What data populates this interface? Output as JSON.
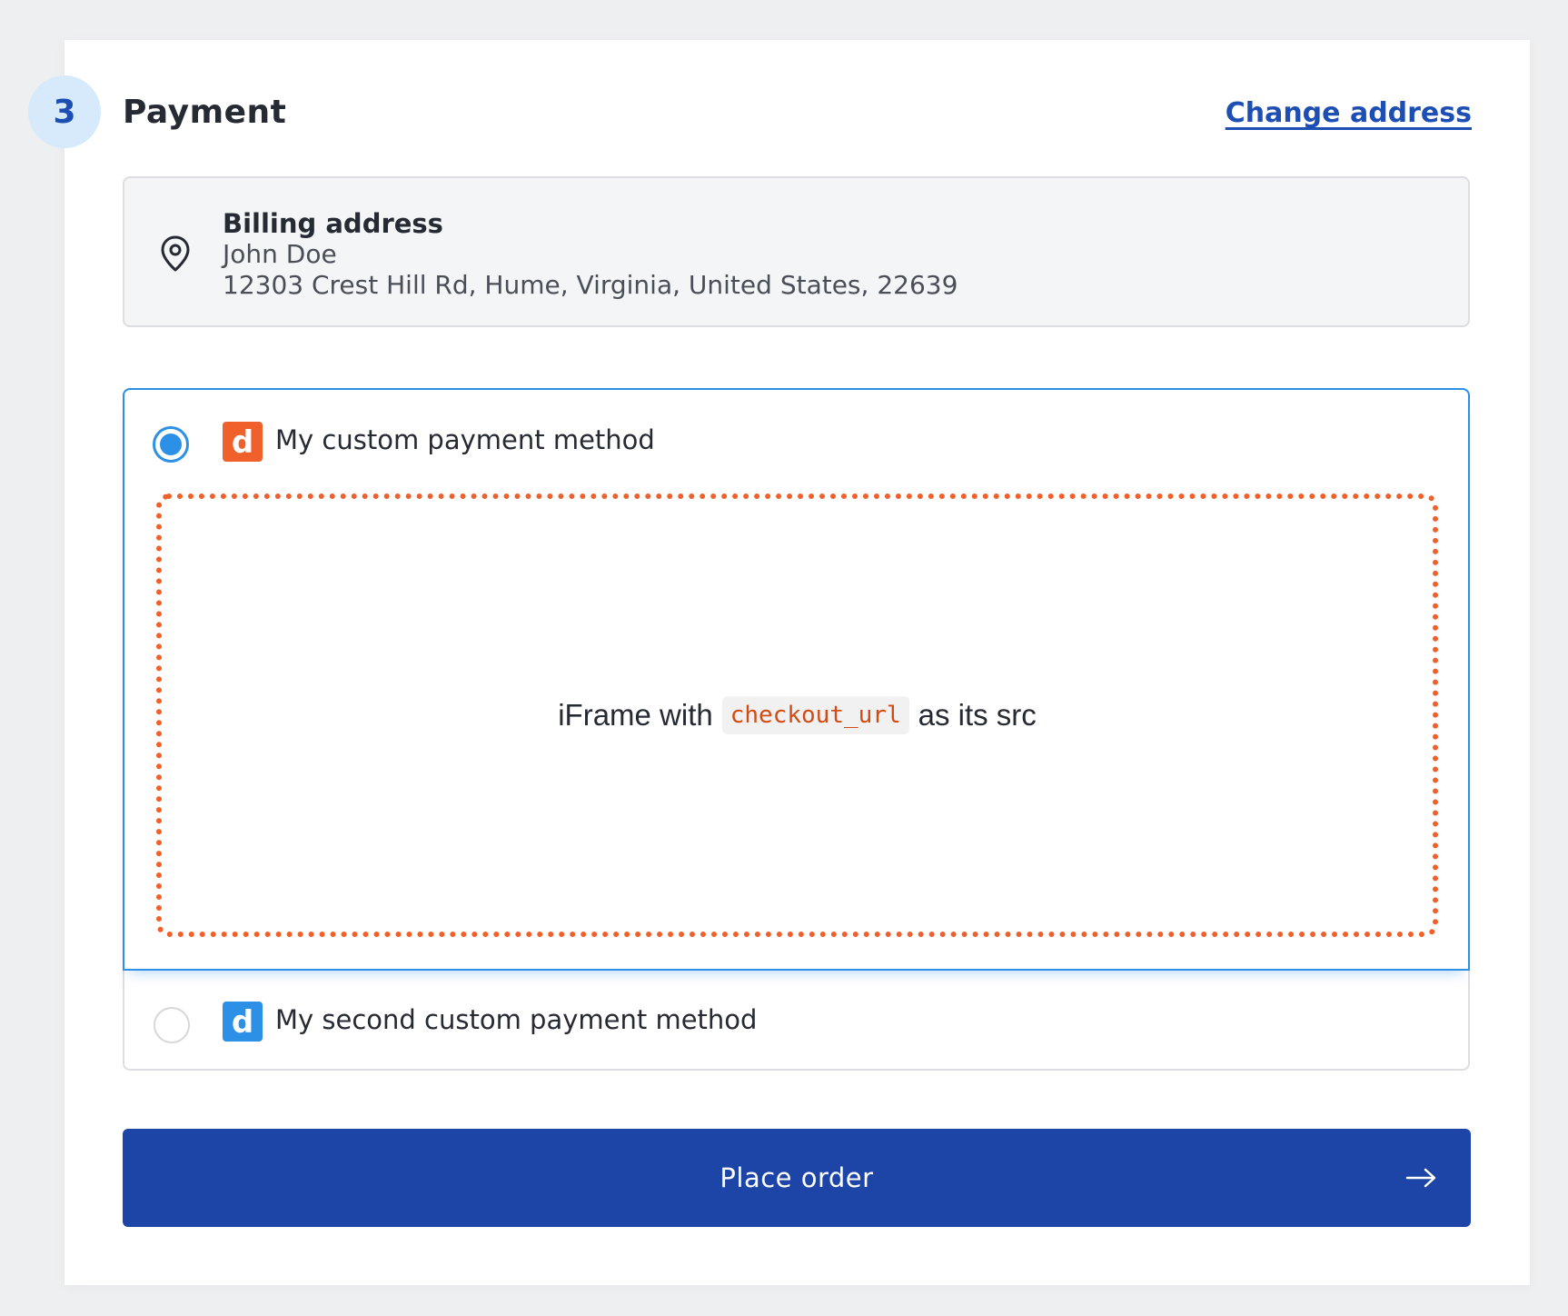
{
  "section": {
    "step_number": "3",
    "title": "Payment",
    "change_address_link": "Change address"
  },
  "billing": {
    "heading": "Billing address",
    "name": "John Doe",
    "address": "12303 Crest Hill Rd, Hume, Virginia, United States, 22639",
    "icon": "location-pin-icon"
  },
  "payment_methods": [
    {
      "label": "My custom payment method",
      "logo_letter": "d",
      "logo_color": "#f0602b",
      "selected": true
    },
    {
      "label": "My second custom payment method",
      "logo_letter": "d",
      "logo_color": "#2b90e6",
      "selected": false
    }
  ],
  "iframe_placeholder": {
    "prefix": "iFrame with",
    "code": "checkout_url",
    "suffix": "as its src"
  },
  "place_order": {
    "label": "Place order",
    "icon": "arrow-right-icon"
  },
  "colors": {
    "primary": "#1d45a8",
    "accent": "#2b90e6",
    "orange": "#f0602b",
    "step_circle_bg": "#d6eafb"
  }
}
